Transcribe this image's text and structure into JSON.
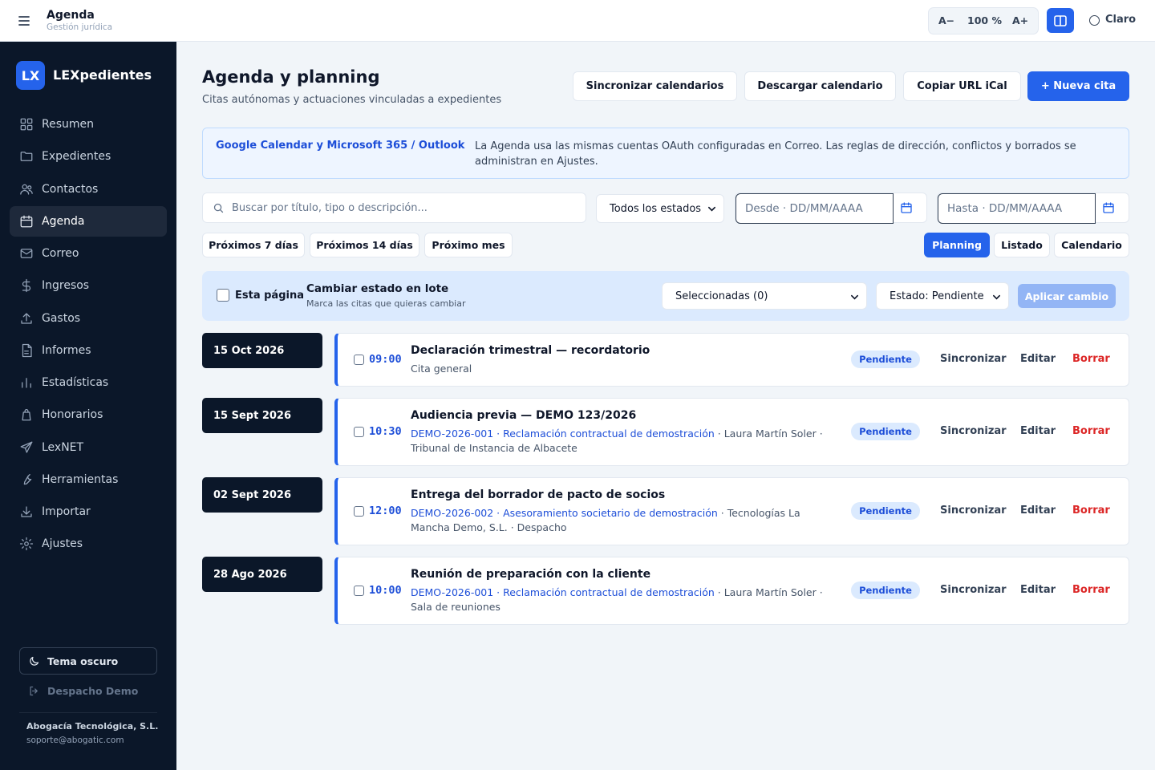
{
  "topbar": {
    "title": "Agenda",
    "subtitle": "Gestión jurídica",
    "zoom_decrease": "A−",
    "zoom_value": "100 %",
    "zoom_increase": "A+",
    "theme_label": "Claro"
  },
  "sidebar": {
    "logo": "LX",
    "brand": "LEXpedientes",
    "items": [
      {
        "label": "Resumen",
        "icon": "grid-icon"
      },
      {
        "label": "Expedientes",
        "icon": "folder-icon"
      },
      {
        "label": "Contactos",
        "icon": "users-icon"
      },
      {
        "label": "Agenda",
        "icon": "calendar-icon",
        "active": true
      },
      {
        "label": "Correo",
        "icon": "mail-icon"
      },
      {
        "label": "Ingresos",
        "icon": "dollar-icon"
      },
      {
        "label": "Gastos",
        "icon": "upload-icon"
      },
      {
        "label": "Informes",
        "icon": "file-icon"
      },
      {
        "label": "Estadísticas",
        "icon": "bar-chart-icon"
      },
      {
        "label": "Honorarios",
        "icon": "bag-icon"
      },
      {
        "label": "LexNET",
        "icon": "send-icon"
      },
      {
        "label": "Herramientas",
        "icon": "wrench-icon"
      },
      {
        "label": "Importar",
        "icon": "download-icon"
      },
      {
        "label": "Ajustes",
        "icon": "gear-icon"
      }
    ],
    "dark_theme": "Tema oscuro",
    "demo_office": "Despacho Demo",
    "company": "Abogacía Tecnológica, S.L.",
    "email": "soporte@abogatic.com"
  },
  "header": {
    "title": "Agenda y planning",
    "subtitle": "Citas autónomas y actuaciones vinculadas a expedientes",
    "sync_btn": "Sincronizar calendarios",
    "download_btn": "Descargar calendario",
    "copy_btn": "Copiar URL iCal",
    "new_btn": "+ Nueva cita"
  },
  "info": {
    "strong": "Google Calendar y Microsoft 365 / Outlook",
    "text": "La Agenda usa las mismas cuentas OAuth configuradas en Correo. Las reglas de dirección, conflictos y borrados se administran en Ajustes."
  },
  "filters": {
    "search_placeholder": "Buscar por título, tipo o descripción...",
    "status_select": "Todos los estados",
    "from_placeholder": "Desde · DD/MM/AAAA",
    "to_placeholder": "Hasta · DD/MM/AAAA",
    "quick": [
      "Próximos 7 días",
      "Próximos 14 días",
      "Próximo mes"
    ],
    "views": [
      "Planning",
      "Listado",
      "Calendario"
    ],
    "active_view": "Planning"
  },
  "batch": {
    "page_label": "Esta página",
    "title": "Cambiar estado en lote",
    "subtitle": "Marca las citas que quieras cambiar",
    "selected": "Seleccionadas (0)",
    "status": "Estado: Pendiente",
    "apply": "Aplicar cambio"
  },
  "events": [
    {
      "date": "15 Oct 2026",
      "time": "09:00",
      "title": "Declaración trimestral — recordatorio",
      "plain": "Cita general",
      "status": "Pendiente"
    },
    {
      "date": "15 Sept 2026",
      "time": "10:30",
      "title": "Audiencia previa — DEMO 123/2026",
      "link": "DEMO-2026-001 · Reclamación contractual de demostración",
      "rest": " · Laura Martín Soler · Tribunal de Instancia de Albacete",
      "status": "Pendiente"
    },
    {
      "date": "02 Sept 2026",
      "time": "12:00",
      "title": "Entrega del borrador de pacto de socios",
      "link": "DEMO-2026-002 · Asesoramiento societario de demostración",
      "rest": " · Tecnologías La Mancha Demo, S.L. · Despacho",
      "status": "Pendiente"
    },
    {
      "date": "28 Ago 2026",
      "time": "10:00",
      "title": "Reunión de preparación con la cliente",
      "link": "DEMO-2026-001 · Reclamación contractual de demostración",
      "rest": " · Laura Martín Soler · Sala de reuniones",
      "status": "Pendiente"
    }
  ],
  "event_actions": {
    "sync": "Sincronizar",
    "edit": "Editar",
    "delete": "Borrar"
  }
}
